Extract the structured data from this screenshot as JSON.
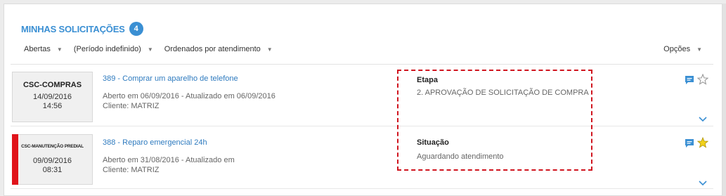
{
  "header": {
    "title": "MINHAS SOLICITAÇÕES",
    "count": "4"
  },
  "filters": {
    "status": "Abertas",
    "period": "(Período indefinido)",
    "order": "Ordenados por atendimento",
    "options": "Opções"
  },
  "tickets": [
    {
      "category": "CSC-COMPRAS",
      "date": "14/09/2016",
      "time": "14:56",
      "title": "389 - Comprar um aparelho de telefone",
      "opened": "Aberto em 06/09/2016 - Atualizado em 06/09/2016",
      "client": "Cliente: MATRIZ",
      "info_label": "Etapa",
      "info_value": "2. APROVAÇÃO DE SOLICITAÇÃO DE COMPRA",
      "starred": false
    },
    {
      "category": "CSC-MANUTENÇÃO PREDIAL",
      "date": "09/09/2016",
      "time": "08:31",
      "title": "388 - Reparo emergencial 24h",
      "opened": "Aberto em 31/08/2016 - Atualizado em",
      "client": "Cliente: MATRIZ",
      "info_label": "Situação",
      "info_value": "Aguardando atendimento",
      "starred": true,
      "priority_color": "#e0141b"
    }
  ],
  "colors": {
    "accent": "#3a8fd3",
    "link": "#2f7bbf",
    "highlight_border": "#d0151f",
    "star_active": "#f2d21a"
  },
  "icons": {
    "comment": "chat-bubble-icon",
    "star": "star-icon",
    "expand": "chevron-down-icon",
    "dropdown": "caret-down-icon"
  }
}
